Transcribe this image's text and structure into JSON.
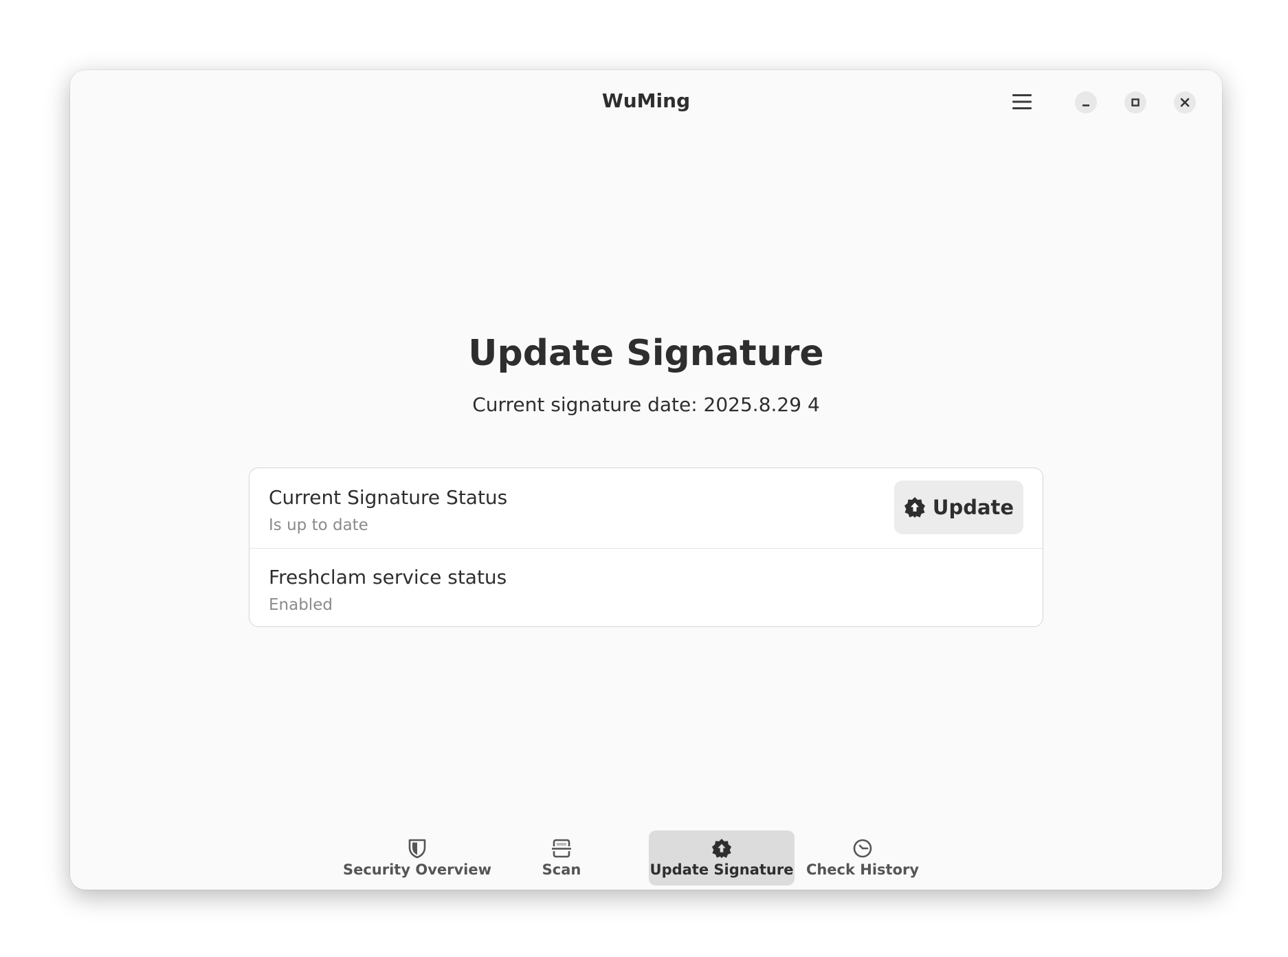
{
  "window": {
    "title": "WuMing"
  },
  "titlebar": {
    "menu_icon": "hamburger-menu-icon",
    "minimize_icon": "minimize-icon",
    "maximize_icon": "maximize-icon",
    "close_icon": "close-icon"
  },
  "main": {
    "title": "Update Signature",
    "signature_date": "Current signature date: 2025.8.29 4"
  },
  "status_card": {
    "rows": [
      {
        "title": "Current Signature Status",
        "subtitle": "Is up to date"
      },
      {
        "title": "Freshclam service status",
        "subtitle": "Enabled"
      }
    ],
    "update_button": {
      "label": "Update",
      "icon": "badge-upload-icon"
    }
  },
  "bottom_nav": {
    "items": [
      {
        "label": "Security Overview",
        "icon": "shield-icon",
        "active": false
      },
      {
        "label": "Scan",
        "icon": "scan-icon",
        "active": false
      },
      {
        "label": "Update Signature",
        "icon": "badge-upload-icon",
        "active": true
      },
      {
        "label": "Check History",
        "icon": "clock-icon",
        "active": false
      }
    ]
  },
  "colors": {
    "window_bg": "#fafafa",
    "card_bg": "#ffffff",
    "active_tab_bg": "#dcdcdc",
    "text_primary": "#2e2e2e",
    "text_secondary": "#8a8a8a"
  }
}
